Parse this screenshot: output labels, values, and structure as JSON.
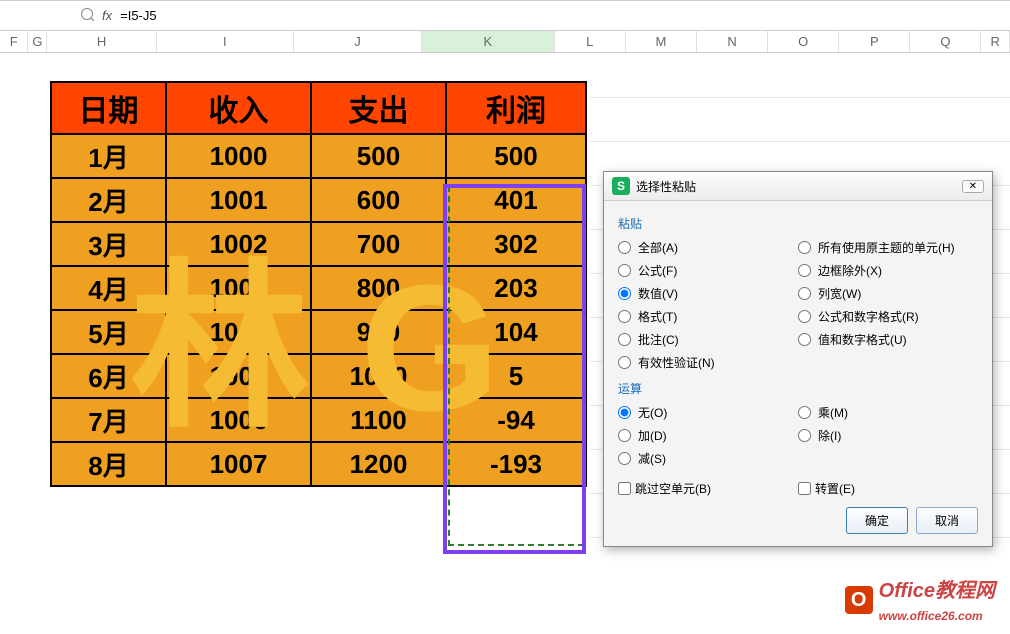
{
  "formula_bar": {
    "fx_label": "fx",
    "formula": "=I5-J5"
  },
  "columns": [
    "F",
    "G",
    "H",
    "I",
    "J",
    "K",
    "L",
    "M",
    "N",
    "O",
    "P",
    "Q",
    "R"
  ],
  "table": {
    "headers": {
      "date": "日期",
      "income": "收入",
      "expense": "支出",
      "profit": "利润"
    },
    "rows": [
      {
        "date": "1月",
        "income": "1000",
        "expense": "500",
        "profit": "500"
      },
      {
        "date": "2月",
        "income": "1001",
        "expense": "600",
        "profit": "401"
      },
      {
        "date": "3月",
        "income": "1002",
        "expense": "700",
        "profit": "302"
      },
      {
        "date": "4月",
        "income": "1003",
        "expense": "800",
        "profit": "203"
      },
      {
        "date": "5月",
        "income": "1004",
        "expense": "900",
        "profit": "104"
      },
      {
        "date": "6月",
        "income": "1005",
        "expense": "1000",
        "profit": "5"
      },
      {
        "date": "7月",
        "income": "1006",
        "expense": "1100",
        "profit": "-94"
      },
      {
        "date": "8月",
        "income": "1007",
        "expense": "1200",
        "profit": "-193"
      }
    ]
  },
  "dialog": {
    "title": "选择性粘贴",
    "group_paste": "粘贴",
    "group_op": "运算",
    "paste": {
      "all": "全部(A)",
      "formulas": "公式(F)",
      "values": "数值(V)",
      "formats": "格式(T)",
      "comments": "批注(C)",
      "validation": "有效性验证(N)",
      "theme": "所有使用原主题的单元(H)",
      "noborder": "边框除外(X)",
      "colwidth": "列宽(W)",
      "formnum": "公式和数字格式(R)",
      "valnum": "值和数字格式(U)"
    },
    "op": {
      "none": "无(O)",
      "add": "加(D)",
      "sub": "减(S)",
      "mul": "乘(M)",
      "div": "除(I)"
    },
    "skip_blanks": "跳过空单元(B)",
    "transpose": "转置(E)",
    "ok": "确定",
    "cancel": "取消"
  },
  "watermark_chars": "林 G",
  "footer": {
    "text_primary": "Office教程网",
    "text_url": "www.office26.com"
  }
}
